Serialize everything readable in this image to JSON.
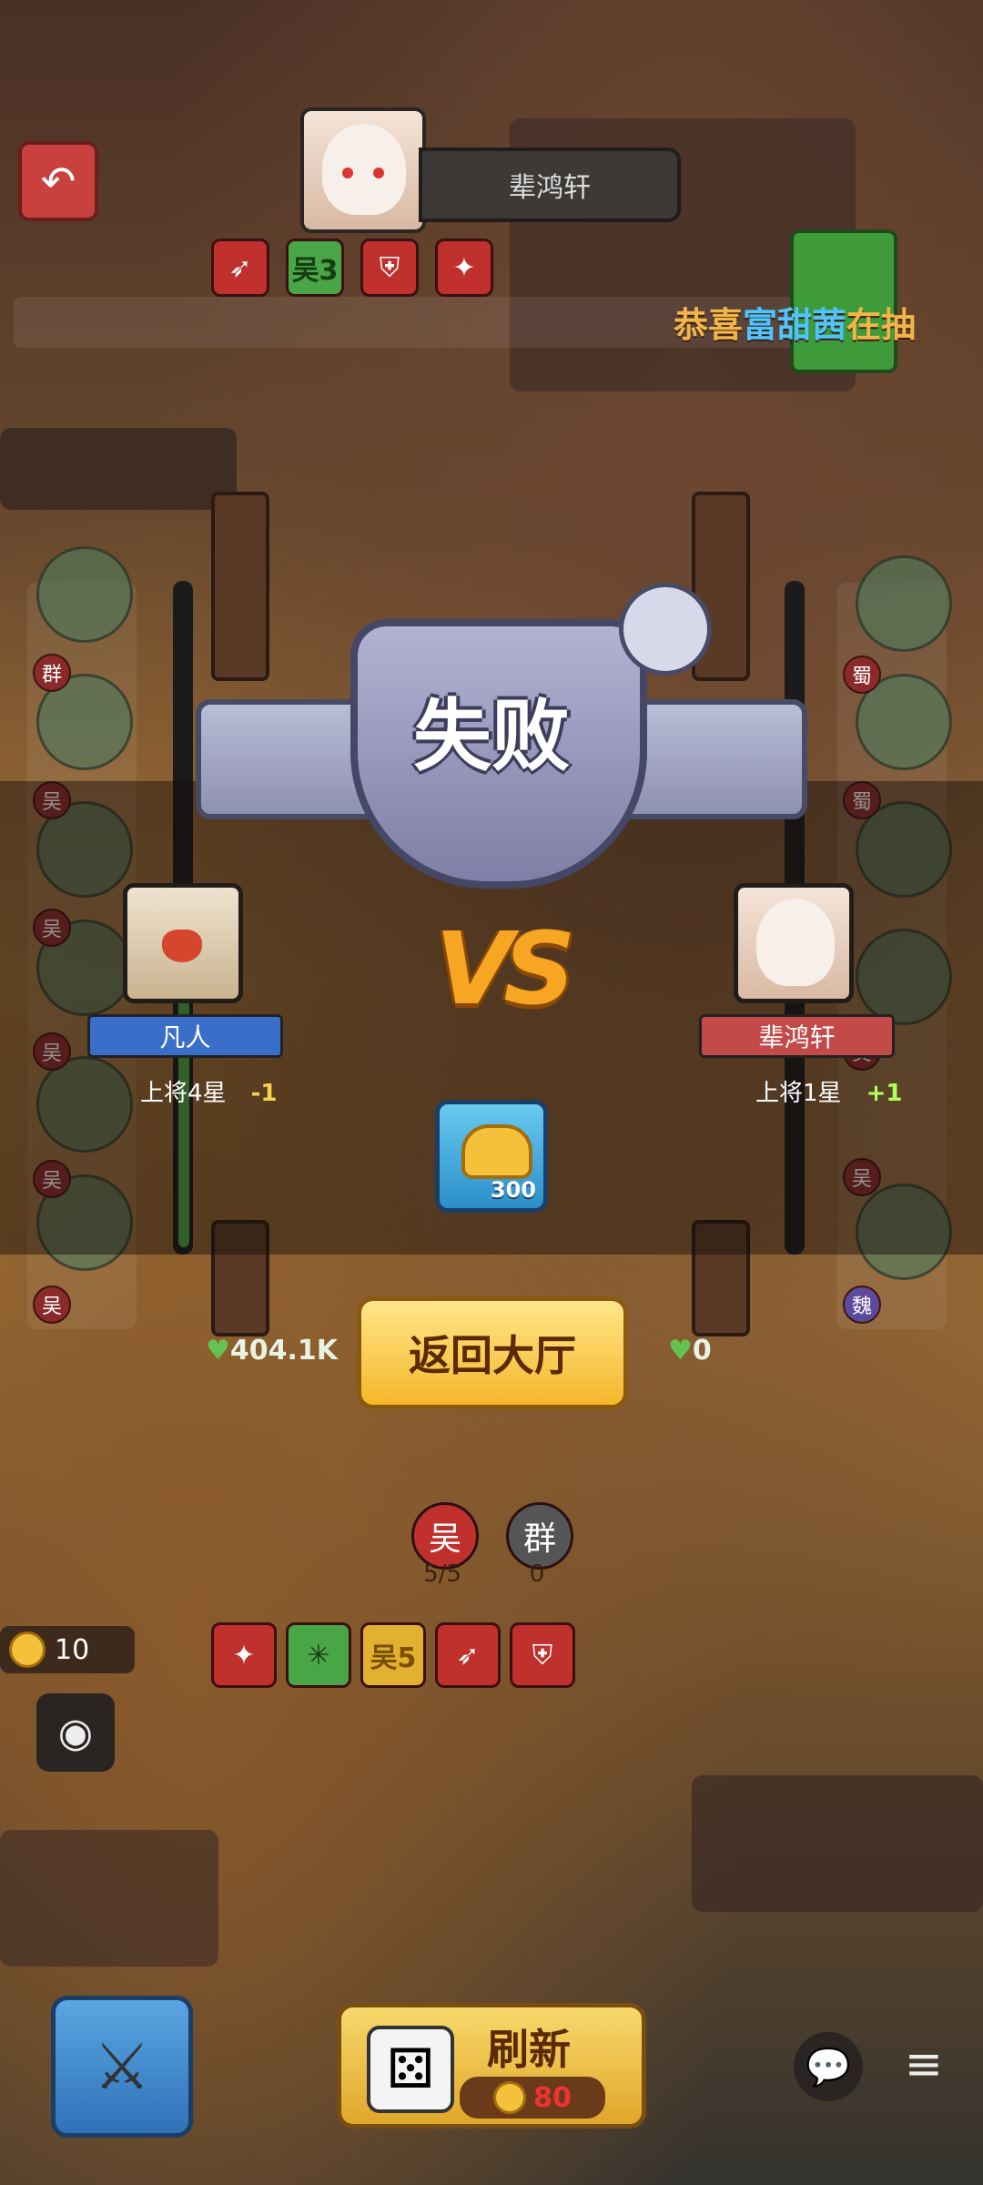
{
  "top": {
    "back_icon": "back-arrow-icon",
    "opponent_name": "辈鸿轩",
    "buffs": [
      {
        "icon": "wing-icon",
        "label": ""
      },
      {
        "icon": "faction-icon",
        "label": "吴3"
      },
      {
        "icon": "shield-icon",
        "label": ""
      },
      {
        "icon": "dragon-icon",
        "label": ""
      }
    ],
    "marquee": {
      "prefix": "恭喜",
      "player": "富甜茜",
      "suffix": "在抽"
    }
  },
  "board": {
    "left_factions": [
      "群",
      "吴",
      "吴",
      "吴",
      "吴",
      "吴"
    ],
    "right_factions": [
      "蜀",
      "蜀",
      "吴",
      "吴",
      "魏"
    ],
    "left_hp": "404.1K",
    "right_hp": "0"
  },
  "result": {
    "title": "失败",
    "vs_text": "VS",
    "left_player": {
      "name": "凡人",
      "rank": "上将4星",
      "delta": "-1"
    },
    "right_player": {
      "name": "辈鸿轩",
      "rank": "上将1星",
      "delta": "+1"
    },
    "reward_amount": "300",
    "return_button": "返回大厅"
  },
  "factions_summary": [
    {
      "label": "吴",
      "count": "5/5",
      "color": "#c0302c"
    },
    {
      "label": "群",
      "count": "0",
      "color": "#555555"
    }
  ],
  "bottom_buffs": [
    {
      "icon": "dragon-icon",
      "label": "",
      "style": "red"
    },
    {
      "icon": "burst-icon",
      "label": "",
      "style": "green"
    },
    {
      "icon": "faction-icon",
      "label": "吴5",
      "style": "yellow"
    },
    {
      "icon": "wing-icon",
      "label": "",
      "style": "red"
    },
    {
      "icon": "shield-icon",
      "label": "",
      "style": "red"
    }
  ],
  "hud": {
    "coins": "10",
    "eye_icon": "eye-icon",
    "weapon_icon": "sword-icon",
    "refresh_label": "刷新",
    "refresh_cost": "80",
    "chat_icon": "chat-icon",
    "menu_icon": "menu-icon"
  },
  "colors": {
    "win": "#b2ff59",
    "lose": "#f5d34a",
    "left_plate": "#3a6fc9",
    "right_plate": "#c44a4a"
  }
}
